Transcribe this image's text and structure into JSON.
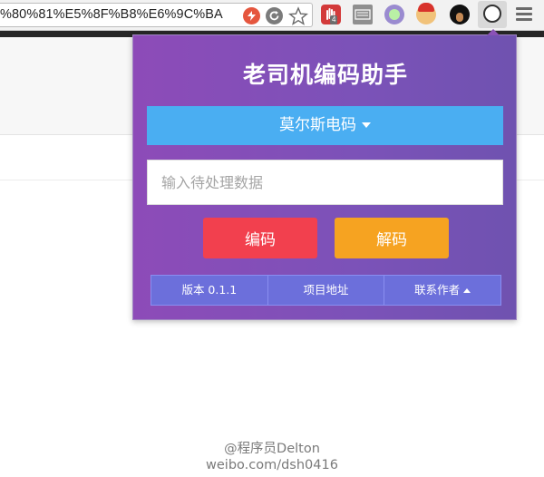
{
  "browser": {
    "url": "%80%81%E5%8F%B8%E6%9C%BA",
    "extension_badge": "4",
    "icons": [
      "lightning-icon",
      "refresh-icon",
      "star-icon",
      "hand-icon",
      "keyboard-icon",
      "circle-icon",
      "santa-icon",
      "afro-icon",
      "extension-active-icon",
      "menu-icon"
    ]
  },
  "popup": {
    "title": "老司机编码助手",
    "encoding_select": "莫尔斯电码",
    "input_placeholder": "输入待处理数据",
    "encode_label": "编码",
    "decode_label": "解码",
    "footer": {
      "version": "版本 0.1.1",
      "project": "项目地址",
      "contact": "联系作者"
    }
  },
  "watermark": {
    "line1": "@程序员Delton",
    "line2": "weibo.com/dsh0416"
  },
  "colors": {
    "popup_bg_start": "#8d4bb8",
    "popup_bg_end": "#6f52b0",
    "select_bg": "#4aaef2",
    "encode_bg": "#f2404e",
    "decode_bg": "#f6a321",
    "footer_bg": "#6c6fdb"
  }
}
